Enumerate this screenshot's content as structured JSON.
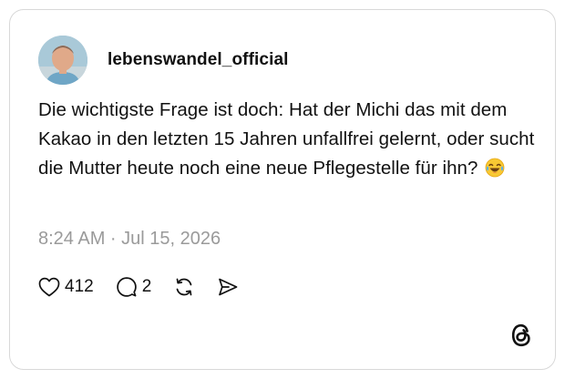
{
  "post": {
    "username": "lebenswandel_official",
    "text": "Die wichtigste Frage ist doch: Hat der Michi das mit dem Kakao in den letzten 15 Jahren unfallfrei gelernt, oder sucht die Mutter heute noch eine neue Pflegestelle für ihn?",
    "emoji_icon": "face-with-tears-of-joy-icon",
    "timestamp": "8:24 AM · Jul 15, 2026"
  },
  "actions": {
    "likes_count": "412",
    "replies_count": "2",
    "like_icon": "heart-icon",
    "reply_icon": "speech-bubble-icon",
    "repost_icon": "repost-icon",
    "share_icon": "send-icon"
  },
  "branding": {
    "logo_icon": "threads-logo-icon"
  },
  "colors": {
    "text": "#111111",
    "muted": "#9a9a9a",
    "border": "#d8d8d8"
  }
}
